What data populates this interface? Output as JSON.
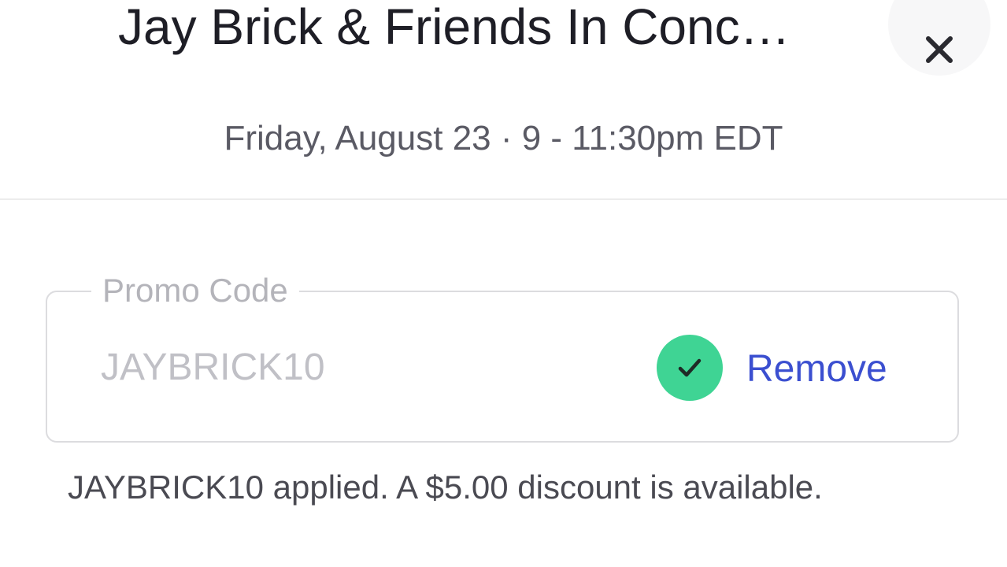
{
  "event": {
    "title": "Jay Brick & Friends In Conc…",
    "date_time": "Friday, August 23 · 9 - 11:30pm EDT"
  },
  "close": {
    "icon": "close-icon"
  },
  "promo": {
    "legend": "Promo Code",
    "value": "JAYBRICK10",
    "status_icon": "check-icon",
    "status_color": "#3fd494",
    "remove_label": "Remove",
    "remove_color": "#3b4fd0",
    "message": "JAYBRICK10 applied. A $5.00 discount is available."
  }
}
